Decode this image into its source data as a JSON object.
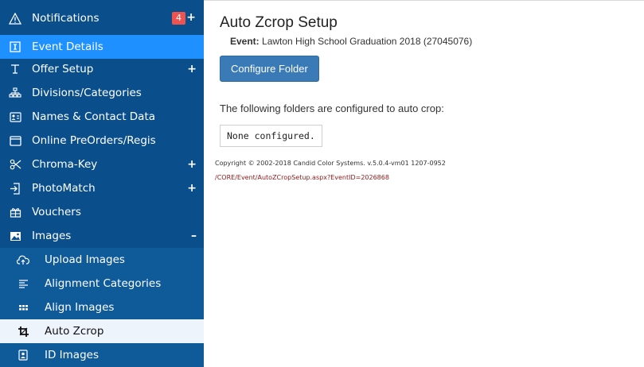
{
  "sidebar": {
    "notifications": {
      "label": "Notifications",
      "badge": "4",
      "expander": "+",
      "icon": "warning-triangle-icon"
    },
    "items": [
      {
        "key": "event-details",
        "label": "Event Details",
        "icon": "info-box-icon",
        "expander": ""
      },
      {
        "key": "offer-setup",
        "label": "Offer Setup",
        "icon": "text-cursor-icon",
        "expander": "+"
      },
      {
        "key": "divisions-categories",
        "label": "Divisions/Categories",
        "icon": "org-chart-icon",
        "expander": ""
      },
      {
        "key": "names-contact-data",
        "label": "Names & Contact Data",
        "icon": "contact-card-icon",
        "expander": ""
      },
      {
        "key": "online-preorders",
        "label": "Online PreOrders/Regis",
        "icon": "browser-window-icon",
        "expander": ""
      },
      {
        "key": "chroma-key",
        "label": "Chroma-Key",
        "icon": "scissors-icon",
        "expander": "+"
      },
      {
        "key": "photomatch",
        "label": "PhotoMatch",
        "icon": "import-icon",
        "expander": "+"
      },
      {
        "key": "vouchers",
        "label": "Vouchers",
        "icon": "gift-icon",
        "expander": ""
      },
      {
        "key": "images",
        "label": "Images",
        "icon": "image-icon",
        "expander": "–"
      }
    ],
    "subitems": [
      {
        "key": "upload-images",
        "label": "Upload Images",
        "icon": "cloud-upload-icon"
      },
      {
        "key": "alignment-categories",
        "label": "Alignment Categories",
        "icon": "align-lines-icon"
      },
      {
        "key": "align-images",
        "label": "Align Images",
        "icon": "grid-dots-icon"
      },
      {
        "key": "auto-zcrop",
        "label": "Auto Zcrop",
        "icon": "crop-icon"
      },
      {
        "key": "id-images",
        "label": "ID Images",
        "icon": "id-badge-icon"
      }
    ]
  },
  "main": {
    "title": "Auto Zcrop Setup",
    "event_label": "Event:",
    "event_value": "Lawton High School Graduation 2018 (27045076)",
    "configure_button": "Configure Folder",
    "folders_text": "The following folders are configured to auto crop:",
    "none_configured": "None configured.",
    "copyright": "Copyright © 2002-2018 Candid Color Systems. v.5.0.4-vm01 1207-0952",
    "page_path": "/CORE/Event/AutoZCropSetup.aspx?EventID=2026868"
  },
  "colors": {
    "sidebar_bg": "#0a4f8c",
    "sidebar_sub_bg": "#0f5a99",
    "active_blue": "#1e90ff",
    "current_bg": "#eef4fb",
    "badge_red": "#ef5350",
    "button_blue": "#3a7ab7",
    "path_red": "#8b1a1a"
  }
}
